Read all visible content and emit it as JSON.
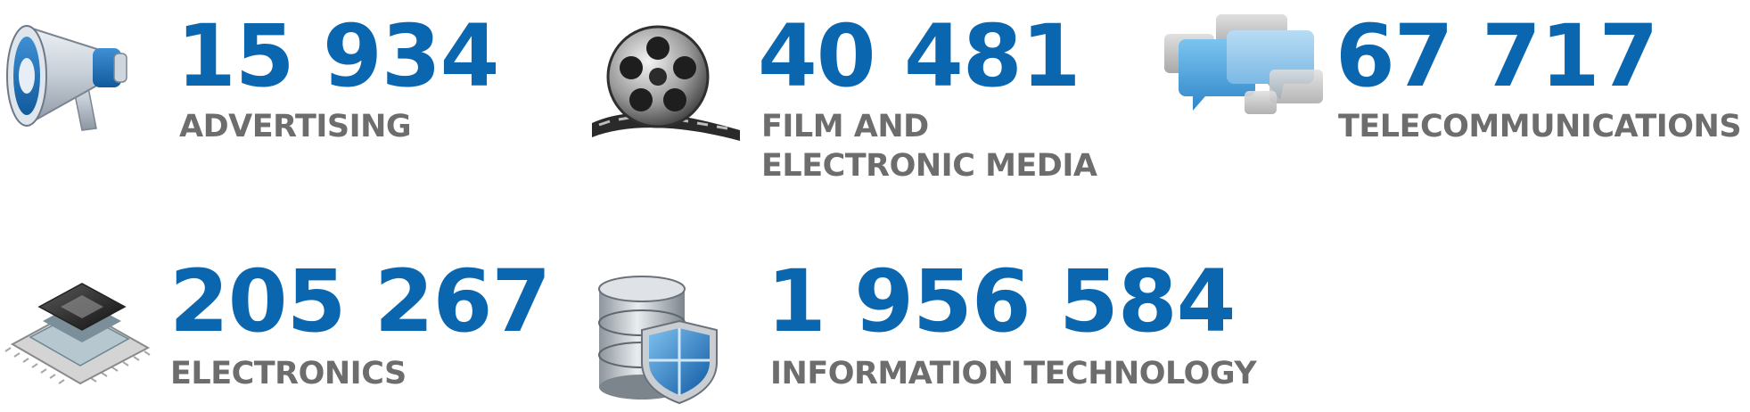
{
  "colors": {
    "value": "#0b66b0",
    "label": "#6d6d6d"
  },
  "stats": [
    {
      "value": "15 934",
      "label_lines": [
        "ADVERTISING"
      ],
      "icon": "megaphone-icon"
    },
    {
      "value": "40 481",
      "label_lines": [
        "FILM AND",
        "ELECTRONIC MEDIA"
      ],
      "icon": "film-reel-icon"
    },
    {
      "value": "67 717",
      "label_lines": [
        "TELECOMMUNICATIONS"
      ],
      "icon": "chat-bubbles-icon"
    },
    {
      "value": "205 267",
      "label_lines": [
        "ELECTRONICS"
      ],
      "icon": "microchip-icon"
    },
    {
      "value": "1 956 584",
      "label_lines": [
        "INFORMATION TECHNOLOGY"
      ],
      "icon": "database-shield-icon"
    }
  ]
}
